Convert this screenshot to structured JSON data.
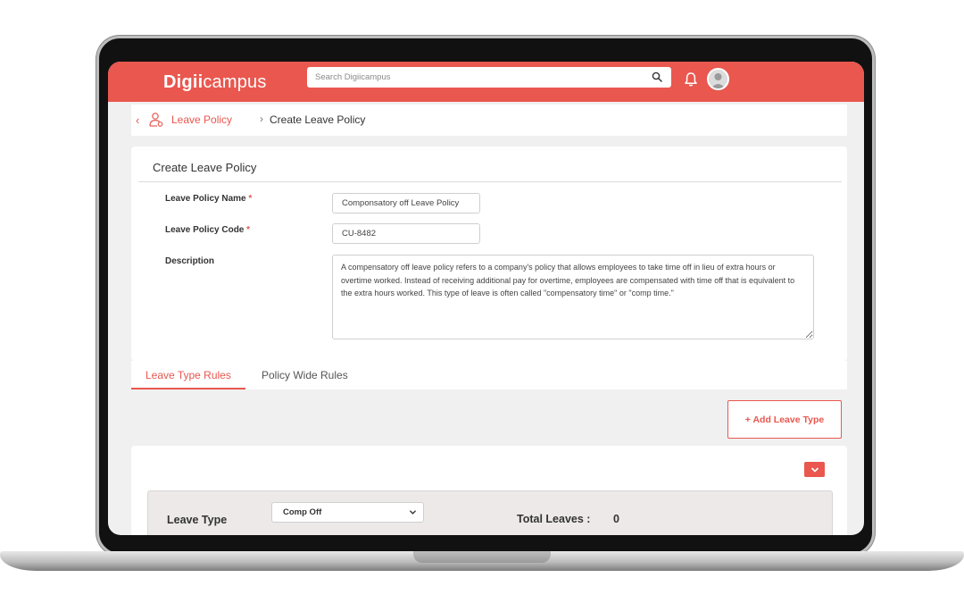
{
  "app": {
    "logo_bold": "Digii",
    "logo_light": "campus",
    "search_placeholder": "Search Digiicampus",
    "accent_color": "#e9574f"
  },
  "icons": {
    "search": "search-icon",
    "bell": "bell-icon",
    "avatar": "user-avatar-icon",
    "back": "chevron-left-icon",
    "policy": "user-policy-icon",
    "collapse": "chevron-down-icon"
  },
  "breadcrumb": {
    "back": "‹",
    "parent": "Leave Policy",
    "separator": "›",
    "current": "Create Leave Policy"
  },
  "form": {
    "title": "Create Leave Policy",
    "required_mark": "*",
    "name_label": "Leave Policy Name",
    "name_value": "Componsatory off Leave Policy",
    "code_label": "Leave Policy Code",
    "code_value": "CU-8482",
    "description_label": "Description",
    "description_value": "A compensatory off leave policy refers to a company's policy that allows employees to take time off in lieu of extra hours or overtime worked. Instead of receiving additional pay for overtime, employees are compensated with time off that is equivalent to the extra hours worked. This type of leave is often called \"compensatory time\" or \"comp time.\""
  },
  "tabs": [
    {
      "label": "Leave Type Rules",
      "active": true
    },
    {
      "label": "Policy Wide Rules",
      "active": false
    }
  ],
  "rules": {
    "add_button": "+ Add Leave Type",
    "leave_type_label": "Leave Type",
    "leave_type_selected": "Comp Off",
    "total_leaves_label": "Total Leaves :",
    "total_leaves_value": "0"
  }
}
